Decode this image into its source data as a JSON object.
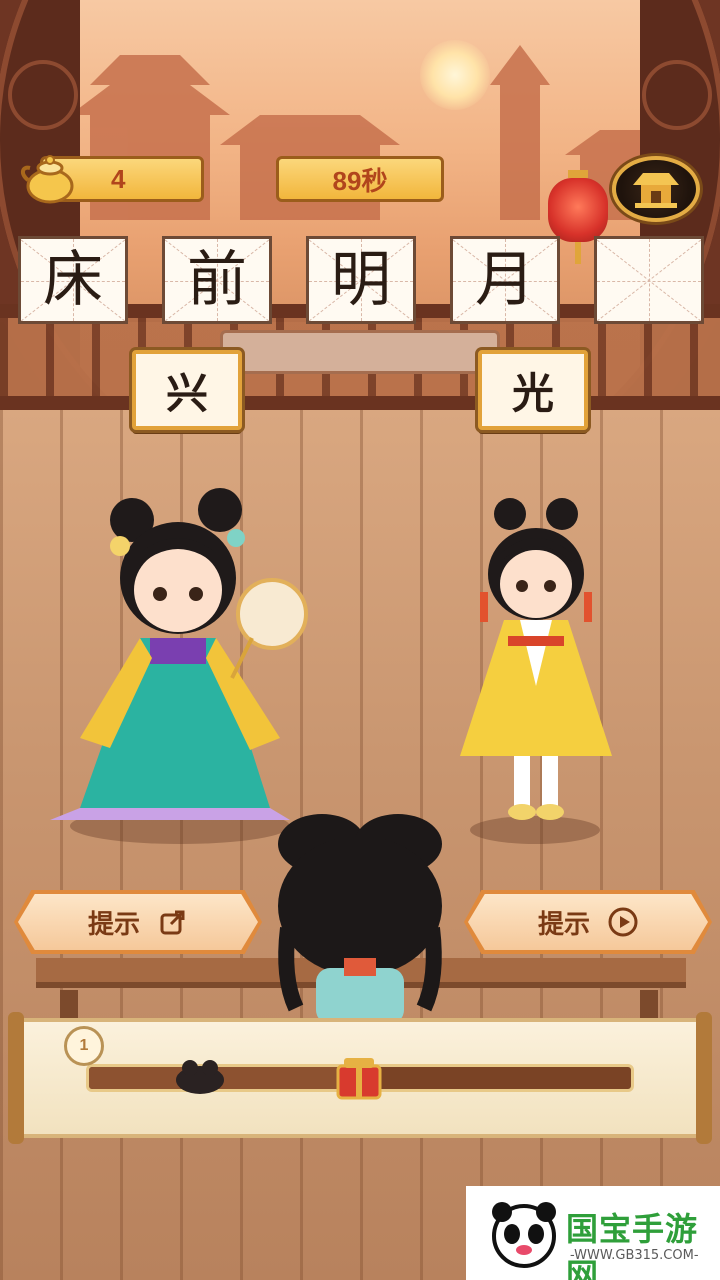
{
  "hud": {
    "level": "4",
    "timer": "89秒"
  },
  "poem": {
    "characters": [
      "床",
      "前",
      "明",
      "月",
      ""
    ]
  },
  "options": [
    "兴",
    "光"
  ],
  "hints": {
    "left_label": "提示",
    "right_label": "提示",
    "left_icon": "share-icon",
    "right_icon": "play-icon"
  },
  "progress": {
    "stage_badge": "1",
    "fraction": 0.47
  },
  "watermark": {
    "title": "国宝手游网",
    "url": "-WWW.GB315.COM-"
  },
  "colors": {
    "accent_gold": "#f2b63c",
    "text_red": "#b1451c",
    "tile_border": "#e2a23a"
  }
}
